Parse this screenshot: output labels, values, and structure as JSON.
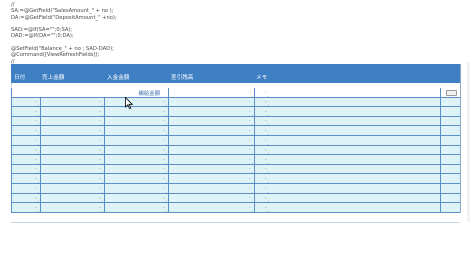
{
  "code_lines": [
    "//",
    "SA:=@GetField(\"SalesAmount_\" + no );",
    "DA:=@GetField(\"DepositAmount_\" +no);",
    "",
    "SAD:=@If(SA=\"\";0;SA);",
    "DAD:=@If(DA=\"\";0;DA);",
    "",
    "@SetField(\"Balance_\" + no ; SAD-DAD);",
    "@Command([ViewRefreshFields]);",
    "//"
  ],
  "table": {
    "headers": [
      "日付",
      "売上金額",
      "入金金額",
      "差引残高",
      "メモ"
    ],
    "subtotal_label": "補給金額",
    "data_row_count": 12
  }
}
